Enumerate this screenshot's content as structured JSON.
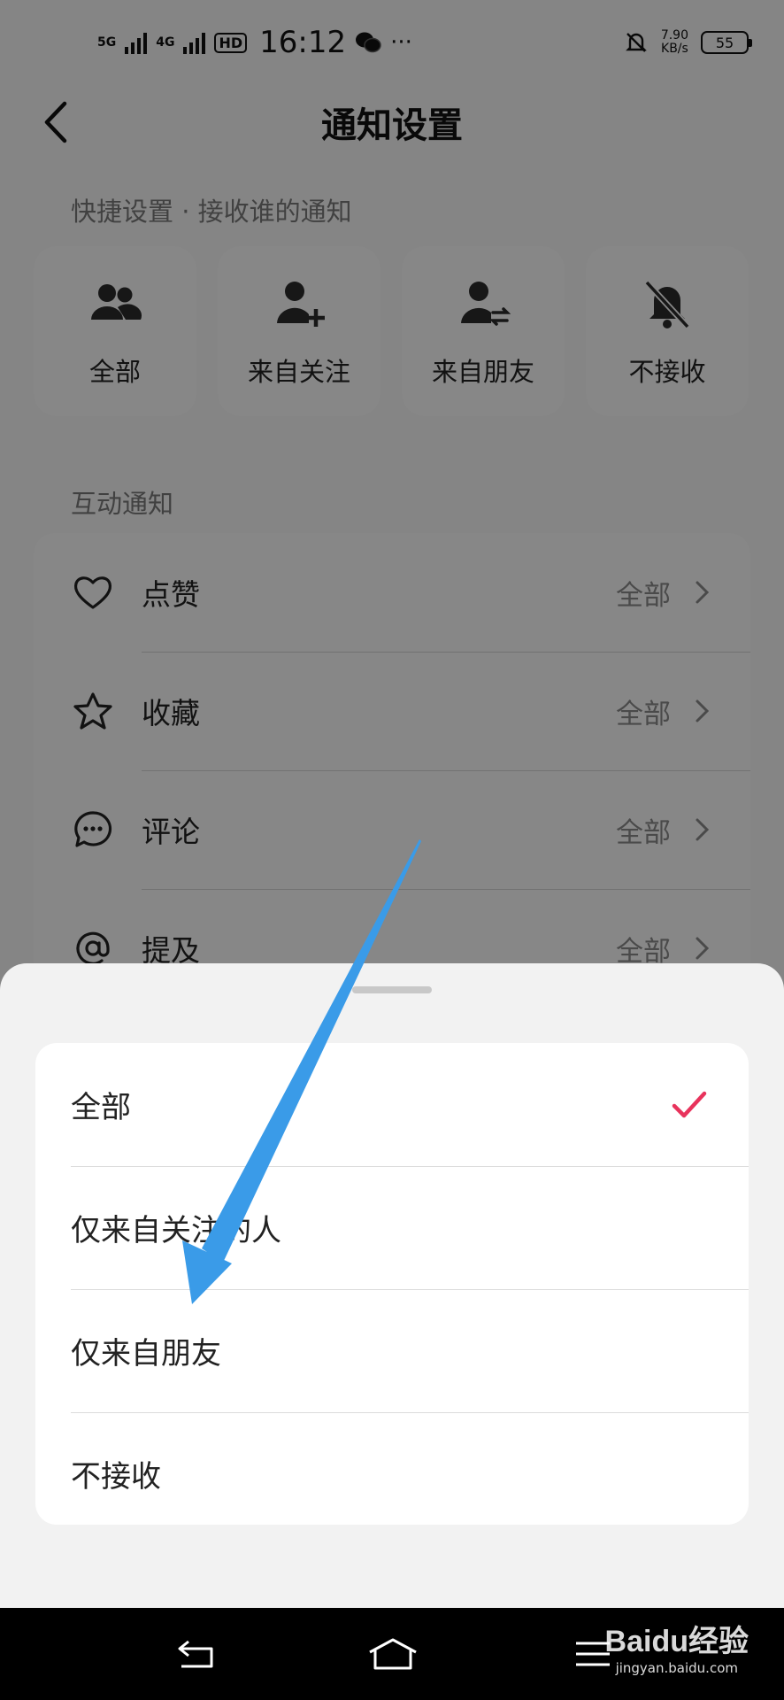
{
  "status_bar": {
    "network_1": "5G",
    "network_2": "4G",
    "hd_badge": "HD",
    "time": "16:12",
    "more": "···",
    "net_speed_value": "7.90",
    "net_speed_unit": "KB/s",
    "battery": "55"
  },
  "header": {
    "title": "通知设置"
  },
  "quick_settings": {
    "label": "快捷设置 · 接收谁的通知",
    "items": [
      {
        "label": "全部",
        "icon": "group-icon"
      },
      {
        "label": "来自关注",
        "icon": "follow-add-icon"
      },
      {
        "label": "来自朋友",
        "icon": "friend-exchange-icon"
      },
      {
        "label": "不接收",
        "icon": "bell-off-icon"
      }
    ]
  },
  "interaction": {
    "label": "互动通知",
    "rows": [
      {
        "label": "点赞",
        "value": "全部",
        "icon": "heart-icon"
      },
      {
        "label": "收藏",
        "value": "全部",
        "icon": "star-icon"
      },
      {
        "label": "评论",
        "value": "全部",
        "icon": "comment-icon"
      },
      {
        "label": "提及",
        "value": "全部",
        "icon": "at-icon"
      }
    ]
  },
  "sheet": {
    "options": [
      {
        "label": "全部",
        "selected": true
      },
      {
        "label": "仅来自关注的人",
        "selected": false
      },
      {
        "label": "仅来自朋友",
        "selected": false
      },
      {
        "label": "不接收",
        "selected": false
      }
    ],
    "check_color": "#e8335c"
  },
  "annotation": {
    "arrow_color": "#3a9be8"
  },
  "watermark": {
    "logo": "Baidu经验",
    "url": "jingyan.baidu.com"
  }
}
